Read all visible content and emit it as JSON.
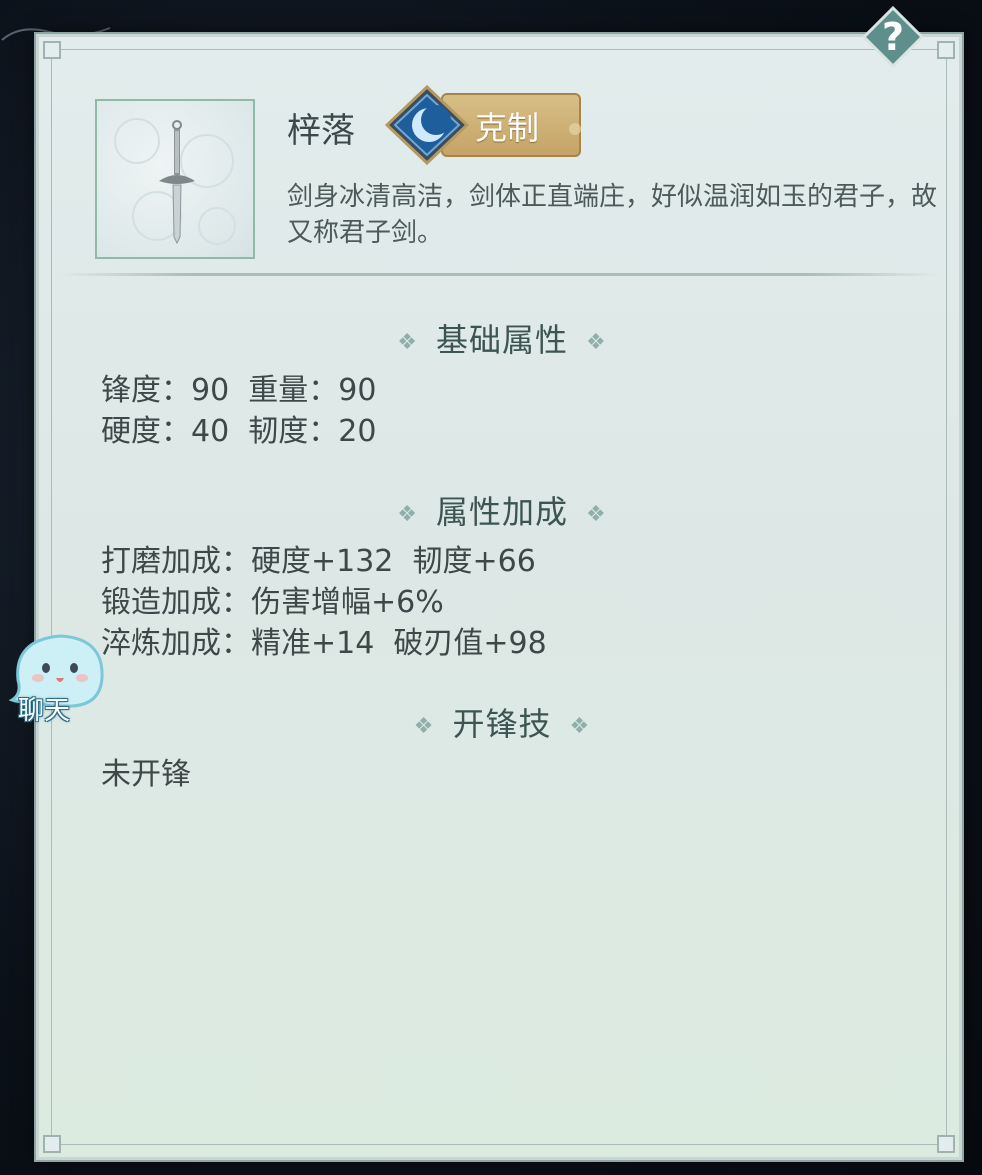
{
  "item": {
    "name": "梓落",
    "badge_label": "克制",
    "badge_icon": "moon-icon",
    "description": "剑身冰清高洁，剑体正直端庄，好似温润如玉的君子，故又称君子剑。"
  },
  "sections": {
    "base": {
      "title": "基础属性",
      "rows": [
        "锋度：90  重量：90",
        "硬度：40  韧度：20"
      ]
    },
    "bonus": {
      "title": "属性加成",
      "rows": [
        "打磨加成：硬度+132  韧度+66",
        "锻造加成：伤害增幅+6%",
        "淬炼加成：精准+14  破刃值+98"
      ]
    },
    "skill": {
      "title": "开锋技",
      "rows": [
        "未开锋"
      ]
    }
  },
  "chat": {
    "label": "聊天",
    "icon": "chat-spirit-icon"
  },
  "help": {
    "icon": "question-icon"
  },
  "colors": {
    "panel": "#dde8e6",
    "accent_gold": "#c5a466",
    "text": "#3e4848",
    "title": "#3d5552"
  }
}
